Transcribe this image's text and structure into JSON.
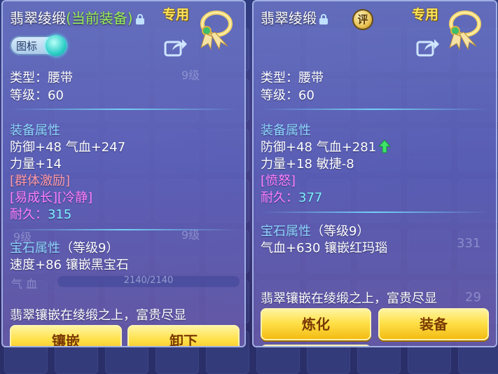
{
  "left_panel": {
    "title": "翡翠绫缎",
    "title_suffix": "(当前装备)",
    "tag": "专用",
    "toggle_label": "图标",
    "type_line": "类型：腰带",
    "level_line": "等级：60",
    "section_equip": "装备属性",
    "stat_line1": "防御+48 气血+247",
    "stat_line2": "力量+14",
    "special1": "[群体激励]",
    "special2": "[易成长][冷静]",
    "durability_label": "耐久：",
    "durability_value": "315",
    "section_gem": "宝石属性",
    "gem_level": "（等级9）",
    "gem_line": "速度+86 镶嵌黑宝石",
    "description": "翡翠镶嵌在绫缎之上，富贵尽显",
    "btn_inlay": "镶嵌",
    "btn_unload": "卸下",
    "bg_hp_label": "气 血",
    "bg_hp_value": "2140/2140",
    "bg_level_9a": "9级",
    "bg_level_9b": "9级",
    "bg_level_9c": "9级"
  },
  "right_panel": {
    "title": "翡翠绫缎",
    "tag": "专用",
    "pin_label": "评",
    "type_line": "类型：腰带",
    "level_line": "等级：60",
    "section_equip": "装备属性",
    "stat_line1": "防御+48 气血+281",
    "stat_line2": "力量+18 敏捷-8",
    "special1": "[愤怒]",
    "durability_label": "耐久：",
    "durability_value": "377",
    "section_gem": "宝石属性",
    "gem_level": "（等级9）",
    "gem_line": "气血+630 镶嵌红玛瑙",
    "description": "翡翠镶嵌在绫缎之上，富贵尽显",
    "btn_refine": "炼化",
    "btn_equip": "装备",
    "bg_count_331": "331",
    "bg_count_29": "29"
  },
  "colors": {
    "title_suffix": "#9af05a",
    "tag": "#ffe65a",
    "section": "#8fd6ff",
    "special_red": "#ff9aa8",
    "special_magenta": "#ff80ff",
    "durability_value": "#7ef2ff",
    "button_gold": "#ffe14a"
  }
}
